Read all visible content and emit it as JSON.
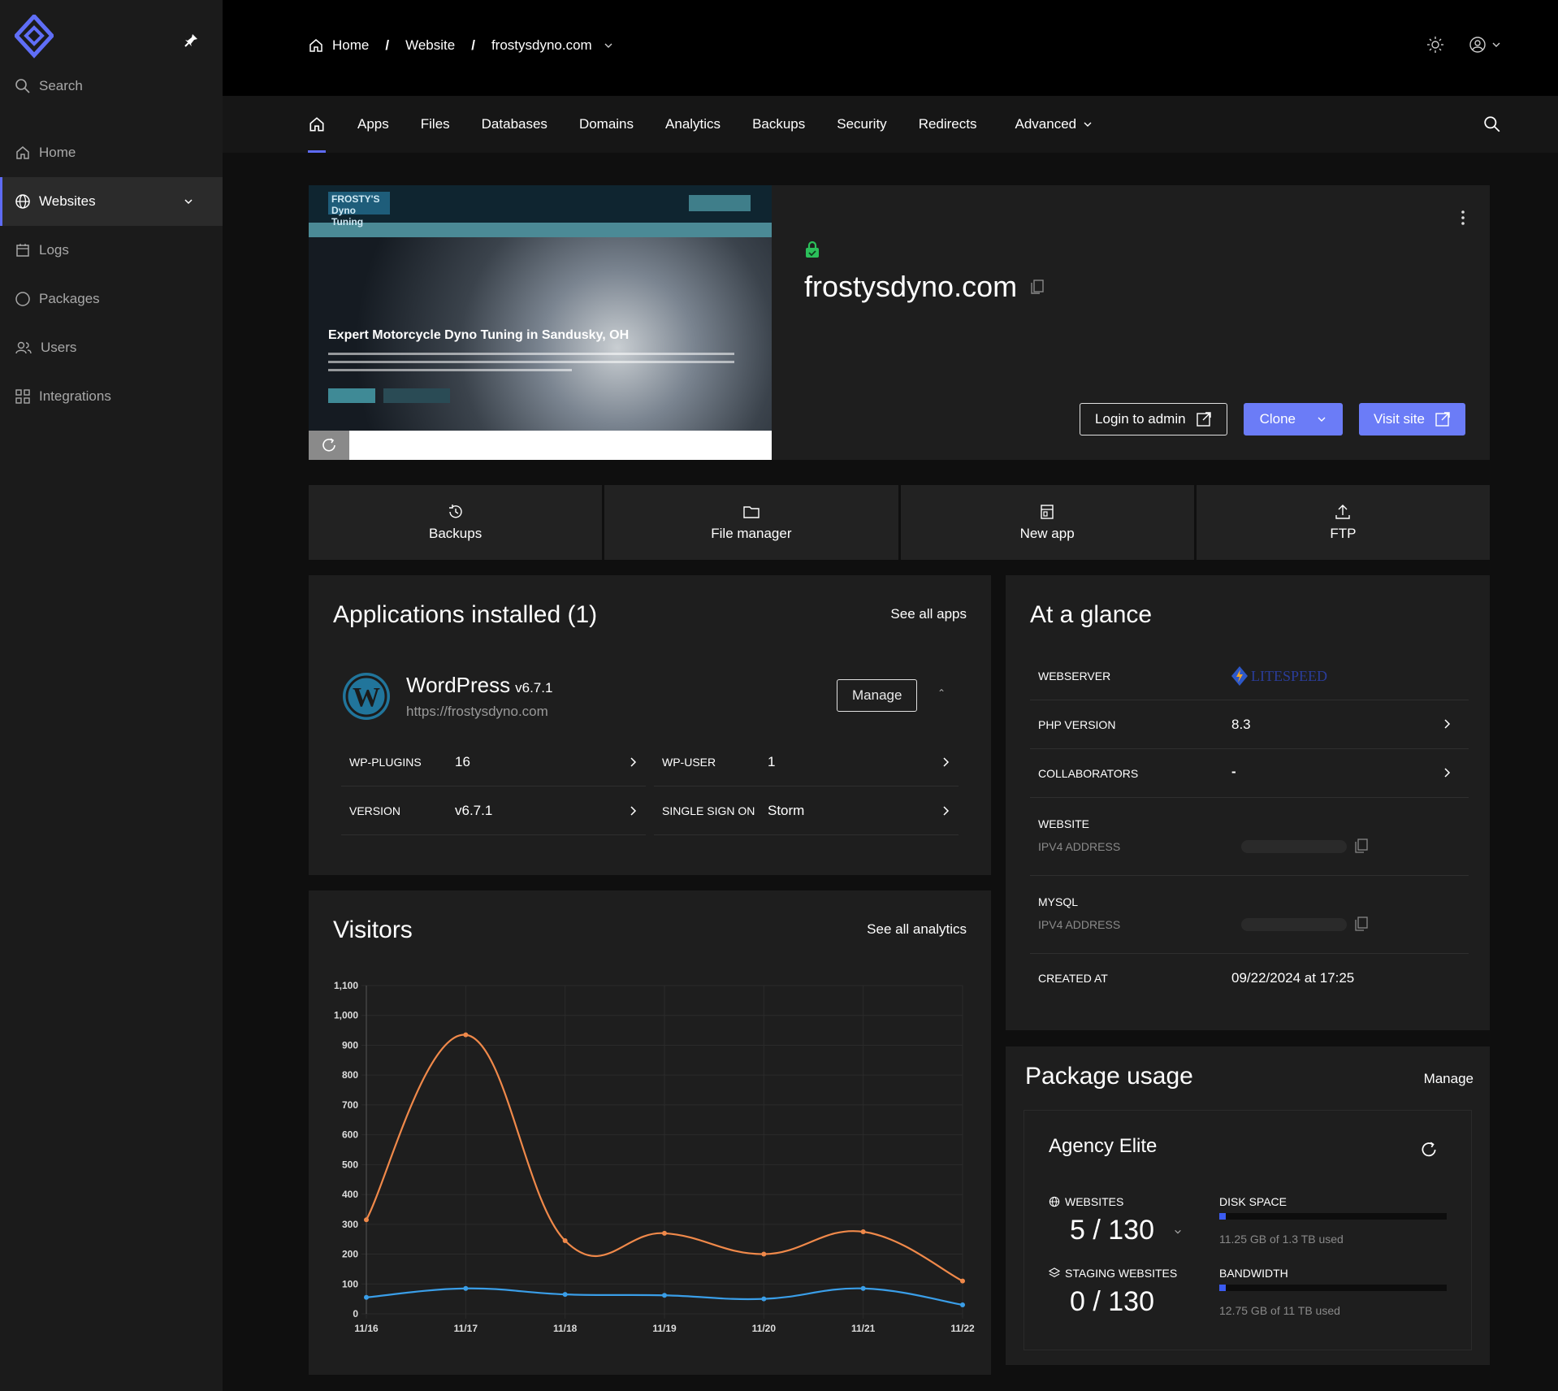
{
  "sidebar": {
    "search_label": "Search",
    "items": [
      {
        "label": "Home",
        "icon": "home-icon"
      },
      {
        "label": "Websites",
        "icon": "globe-icon",
        "active": true
      },
      {
        "label": "Logs",
        "icon": "calendar-icon"
      },
      {
        "label": "Packages",
        "icon": "circle-icon"
      },
      {
        "label": "Users",
        "icon": "users-icon"
      },
      {
        "label": "Integrations",
        "icon": "grid-icon"
      }
    ]
  },
  "breadcrumb": {
    "home": "Home",
    "website": "Website",
    "domain": "frostysdyno.com"
  },
  "tabs": [
    "Apps",
    "Files",
    "Databases",
    "Domains",
    "Analytics",
    "Backups",
    "Security",
    "Redirects",
    "Advanced"
  ],
  "hero": {
    "domain": "frostysdyno.com",
    "login_admin": "Login to admin",
    "clone": "Clone",
    "visit_site": "Visit site",
    "preview_heading": "Expert Motorcycle Dyno Tuning in Sandusky, OH",
    "preview_logo": "FROSTY'S Dyno Tuning"
  },
  "quick_actions": [
    "Backups",
    "File manager",
    "New app",
    "FTP"
  ],
  "apps": {
    "title": "Applications installed (1)",
    "see_all": "See all apps",
    "name": "WordPress",
    "version": "v6.7.1",
    "url": "https://frostysdyno.com",
    "manage": "Manage",
    "rows": [
      {
        "k1": "WP-PLUGINS",
        "v1": "16",
        "k2": "WP-USER",
        "v2": "1"
      },
      {
        "k1": "VERSION",
        "v1": "v6.7.1",
        "k2": "SINGLE SIGN ON",
        "v2": "Storm"
      }
    ]
  },
  "visitors": {
    "title": "Visitors",
    "see_all": "See all analytics"
  },
  "chart_data": {
    "type": "line",
    "x": [
      "11/16",
      "11/17",
      "11/18",
      "11/19",
      "11/20",
      "11/21",
      "11/22"
    ],
    "ylim": [
      0,
      1100
    ],
    "yticks": [
      0,
      100,
      200,
      300,
      400,
      500,
      600,
      700,
      800,
      900,
      "1,000",
      "1,100"
    ],
    "series": [
      {
        "color": "#f0894a",
        "values": [
          315,
          935,
          245,
          270,
          200,
          275,
          110
        ]
      },
      {
        "color": "#3a9ee8",
        "values": [
          55,
          85,
          65,
          62,
          50,
          85,
          30
        ]
      }
    ],
    "grid": true
  },
  "glance": {
    "title": "At a glance",
    "webserver_label": "WEBSERVER",
    "webserver_value": "LITESPEED",
    "php_label": "PHP VERSION",
    "php_value": "8.3",
    "collab_label": "COLLABORATORS",
    "collab_value": "-",
    "website_label": "WEBSITE",
    "website_sub": "IPV4 ADDRESS",
    "mysql_label": "MYSQL",
    "mysql_sub": "IPV4 ADDRESS",
    "created_label": "CREATED AT",
    "created_value": "09/22/2024 at 17:25"
  },
  "package": {
    "title": "Package usage",
    "manage": "Manage",
    "plan": "Agency Elite",
    "websites_label": "WEBSITES",
    "websites_used": "5",
    "websites_total": "130",
    "staging_label": "STAGING WEBSITES",
    "staging_used": "0",
    "staging_total": "130",
    "disk_label": "DISK SPACE",
    "disk_used": "11.25 GB of 1.3 TB used",
    "disk_fraction": 0.009,
    "bandwidth_label": "BANDWIDTH",
    "bandwidth_used": "12.75 GB of 11 TB used",
    "bandwidth_fraction": 0.001
  }
}
